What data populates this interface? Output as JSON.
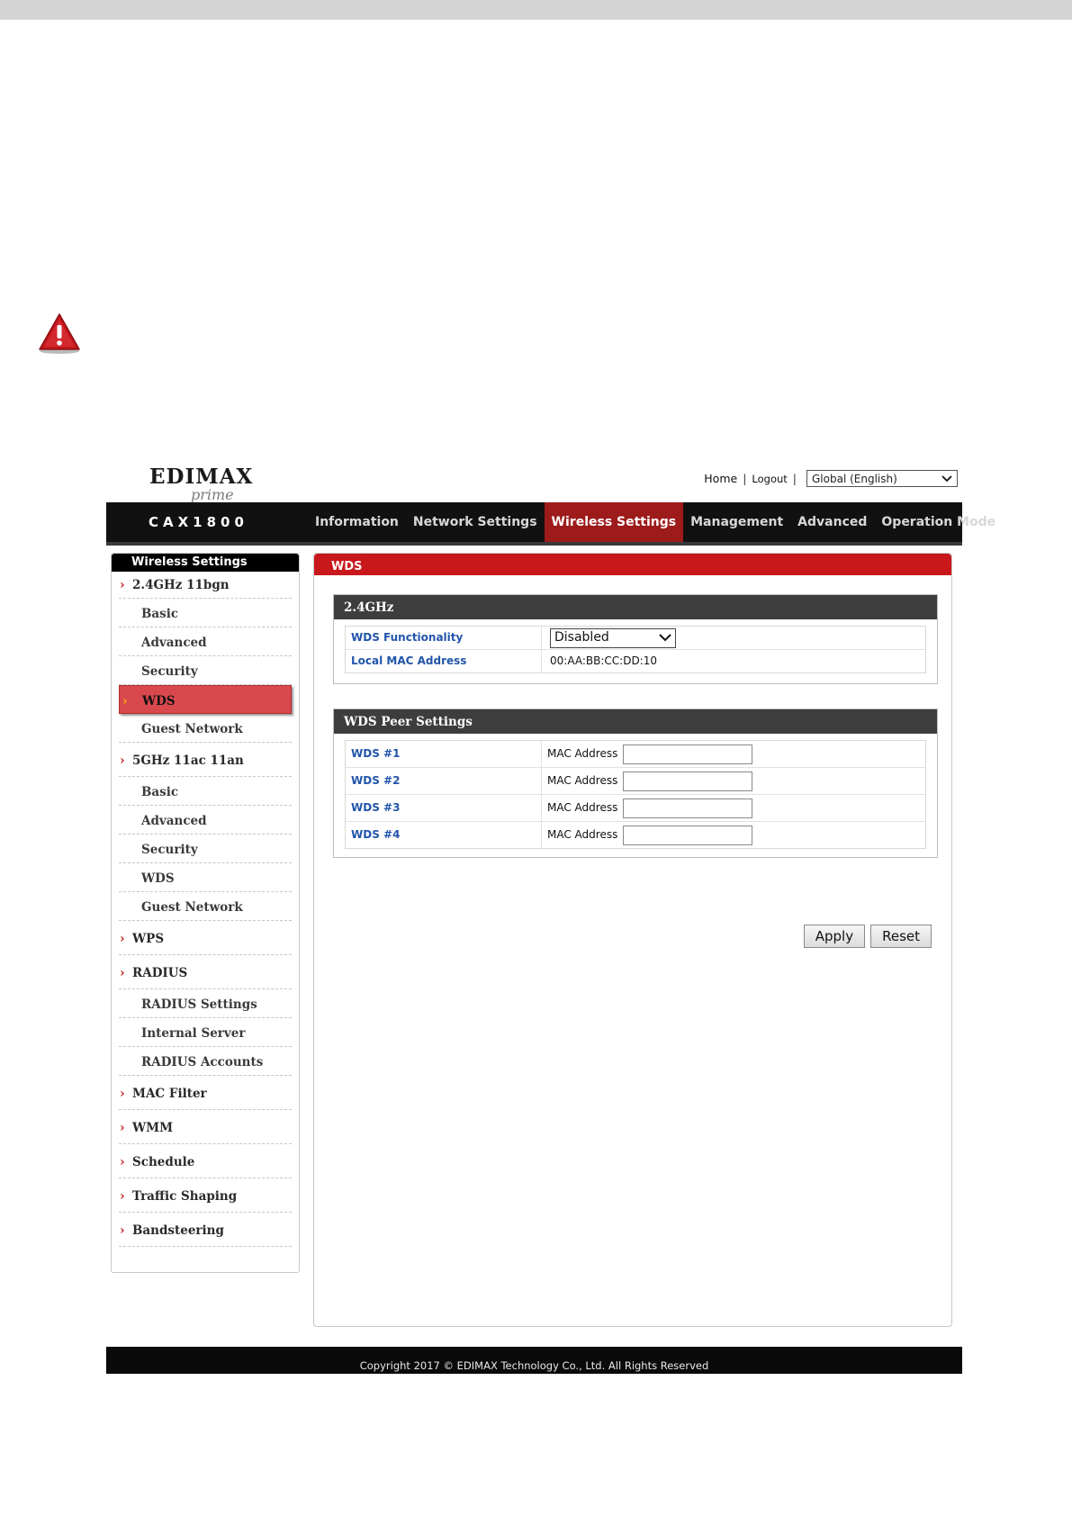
{
  "brand": {
    "logo_main": "EDIMAX",
    "logo_sub": "prime",
    "model": "CAX1800"
  },
  "top_links": {
    "home": "Home",
    "logout": "Logout",
    "separator": "|",
    "language": "Global (English)"
  },
  "nav": {
    "items": [
      {
        "label": "Information",
        "active": false
      },
      {
        "label": "Network Settings",
        "active": false
      },
      {
        "label": "Wireless Settings",
        "active": true
      },
      {
        "label": "Management",
        "active": false
      },
      {
        "label": "Advanced",
        "active": false
      },
      {
        "label": "Operation Mode",
        "active": false
      }
    ]
  },
  "sidebar": {
    "title": "Wireless Settings",
    "items": [
      {
        "label": "2.4GHz 11bgn",
        "type": "category"
      },
      {
        "label": "Basic",
        "type": "sub"
      },
      {
        "label": "Advanced",
        "type": "sub"
      },
      {
        "label": "Security",
        "type": "sub"
      },
      {
        "label": "WDS",
        "type": "sub",
        "active": true
      },
      {
        "label": "Guest Network",
        "type": "sub"
      },
      {
        "label": "5GHz 11ac 11an",
        "type": "category"
      },
      {
        "label": "Basic",
        "type": "sub"
      },
      {
        "label": "Advanced",
        "type": "sub"
      },
      {
        "label": "Security",
        "type": "sub"
      },
      {
        "label": "WDS",
        "type": "sub"
      },
      {
        "label": "Guest Network",
        "type": "sub"
      },
      {
        "label": "WPS",
        "type": "category"
      },
      {
        "label": "RADIUS",
        "type": "category"
      },
      {
        "label": "RADIUS Settings",
        "type": "sub"
      },
      {
        "label": "Internal Server",
        "type": "sub"
      },
      {
        "label": "RADIUS Accounts",
        "type": "sub"
      },
      {
        "label": "MAC Filter",
        "type": "category"
      },
      {
        "label": "WMM",
        "type": "category"
      },
      {
        "label": "Schedule",
        "type": "category"
      },
      {
        "label": "Traffic Shaping",
        "type": "category"
      },
      {
        "label": "Bandsteering",
        "type": "category"
      }
    ]
  },
  "content": {
    "title": "WDS",
    "band_section": {
      "title": "2.4GHz",
      "wds_functionality_label": "WDS Functionality",
      "wds_functionality_value": "Disabled",
      "local_mac_label": "Local MAC Address",
      "local_mac_value": "00:AA:BB:CC:DD:10"
    },
    "peer_section": {
      "title": "WDS Peer Settings",
      "peers": [
        {
          "label": "WDS #1",
          "field_label": "MAC Address",
          "value": ""
        },
        {
          "label": "WDS #2",
          "field_label": "MAC Address",
          "value": ""
        },
        {
          "label": "WDS #3",
          "field_label": "MAC Address",
          "value": ""
        },
        {
          "label": "WDS #4",
          "field_label": "MAC Address",
          "value": ""
        }
      ]
    },
    "buttons": {
      "apply": "Apply",
      "reset": "Reset"
    }
  },
  "footer": {
    "copyright": "Copyright 2017 © EDIMAX Technology Co., Ltd. All Rights Reserved"
  },
  "colors": {
    "accent_red": "#c8181c",
    "nav_active": "#9e1b1b",
    "sidebar_active": "#d9484d",
    "link_blue": "#2255aa"
  }
}
